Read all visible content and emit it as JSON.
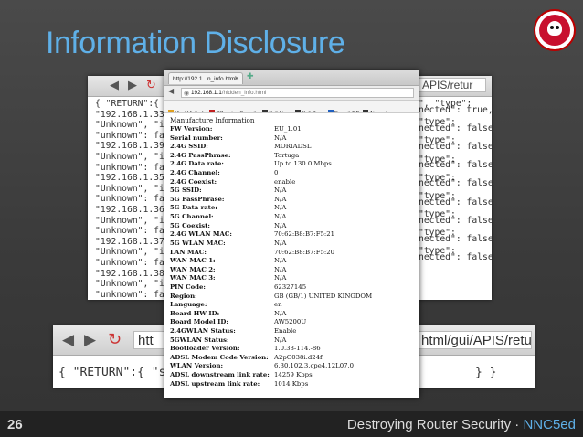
{
  "slide": {
    "title": "Information Disclosure",
    "page_number": "26",
    "footer_main": "Destroying Router Security · ",
    "footer_accent": "NNC5ed"
  },
  "background_browser": {
    "url_fragment": "APIS/retur",
    "json_left": [
      "{ \"RETURN\":{ \"suc",
      "\"192.168.1.33\",",
      "\"Unknown\", \"ipAd",
      "\"unknown\": false",
      "\"192.168.1.39\",",
      "\"Unknown\", \"ipAd",
      "\"unknown\": false",
      "\"192.168.1.35\",",
      "\"Unknown\", \"ipAd",
      "\"unknown\": false",
      "\"192.168.1.36\",",
      "\"Unknown\", \"ipAd",
      "\"unknown\": false",
      "\"192.168.1.37\",",
      "\"Unknown\", \"ipAd",
      "\"unknown\": false",
      "\"192.168.1.38\",",
      "\"Unknown\", \"ipAd",
      "\"unknown\": false",
      "\"192.168.1.34\",",
      "\"Unknown\", \"ipAd"
    ],
    "json_right": [
      "\", \"type\":",
      "nected\": true,",
      "\"type\":",
      "nected\": false,",
      "\"type\":",
      "nected\": false,",
      "\"type\":",
      "nected\": false,",
      "\"type\":",
      "nected\": false,",
      "\"type\":",
      "nected\": false,",
      "\"type\":",
      "nected\": false,",
      "\"type\":",
      "nected\": false,",
      "\"type\":",
      "nected\": false,"
    ]
  },
  "background_browser_2": {
    "url_left": "htt",
    "url_right": "html/gui/APIS/retur",
    "json_left": "{ \"RETURN\":{ \"succe",
    "json_right": "} }"
  },
  "foreground_browser": {
    "tab_title": "http://192.1...n_info.html",
    "url_host": "192.168.1.1",
    "url_path": "/hidden_info.html",
    "bookmarks": [
      {
        "label": "Most Visited▾",
        "icon_color": "#e0a020"
      },
      {
        "label": "Offensive Security",
        "icon_color": "#c02020"
      },
      {
        "label": "Kali Linux",
        "icon_color": "#333333"
      },
      {
        "label": "Kali Docs",
        "icon_color": "#333333"
      },
      {
        "label": "Exploit-DB",
        "icon_color": "#2060c0"
      },
      {
        "label": "Aircrack-",
        "icon_color": "#333333"
      }
    ],
    "heading": "Manufacture Information",
    "rows": [
      {
        "label": "FW Version:",
        "value": "EU_1.01"
      },
      {
        "label": "Serial number:",
        "value": "N/A"
      },
      {
        "label": "2.4G SSID:",
        "value": "MORIADSL"
      },
      {
        "label": "2.4G PassPhrase:",
        "value": "Tortuga"
      },
      {
        "label": "2.4G Data rate:",
        "value": "Up to 130.0 Mbps"
      },
      {
        "label": "2.4G Channel:",
        "value": "0"
      },
      {
        "label": "2.4G Coexist:",
        "value": "enable"
      },
      {
        "label": "5G SSID:",
        "value": "N/A"
      },
      {
        "label": "5G PassPhrase:",
        "value": "N/A"
      },
      {
        "label": "5G Data rate:",
        "value": "N/A"
      },
      {
        "label": "5G Channel:",
        "value": "N/A"
      },
      {
        "label": "5G Coexist:",
        "value": "N/A"
      },
      {
        "label": "2.4G WLAN MAC:",
        "value": "70:62:B8:B7:F5:21"
      },
      {
        "label": "5G WLAN MAC:",
        "value": "N/A"
      },
      {
        "label": "LAN MAC:",
        "value": "70:62:B8:B7:F5:20"
      },
      {
        "label": "WAN MAC 1:",
        "value": "N/A"
      },
      {
        "label": "WAN MAC 2:",
        "value": "N/A"
      },
      {
        "label": "WAN MAC 3:",
        "value": "N/A"
      },
      {
        "label": "PIN Code:",
        "value": "62327145"
      },
      {
        "label": "Region:",
        "value": "GB (GB/1) UNITED KINGDOM"
      },
      {
        "label": "Language:",
        "value": "en"
      },
      {
        "label": "Board HW ID:",
        "value": "N/A"
      },
      {
        "label": "Board Model ID:",
        "value": "AW5200U"
      },
      {
        "label": "2.4GWLAN Status:",
        "value": "Enable"
      },
      {
        "label": "5GWLAN Status:",
        "value": "N/A"
      },
      {
        "label": "Bootloader Version:",
        "value": "1.0.38-114.-86"
      },
      {
        "label": "ADSL Modem Code Version:",
        "value": "A2pG038i.d24f"
      },
      {
        "label": "WLAN Version:",
        "value": "6.30.102.3.cpe4.12L07.0"
      },
      {
        "label": "ADSL downstream link rate:",
        "value": "14259 Kbps"
      },
      {
        "label": "ADSL upstream link rate:",
        "value": "1014 Kbps"
      }
    ]
  }
}
